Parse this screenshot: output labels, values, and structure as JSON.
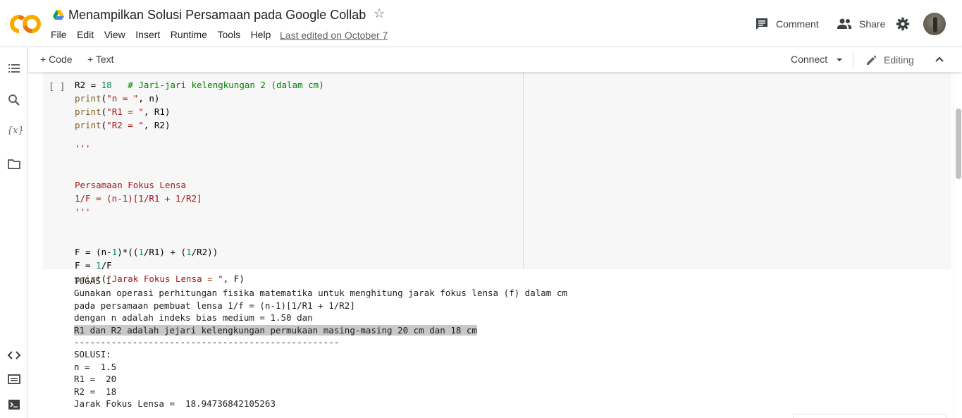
{
  "header": {
    "title": "Menampilkan Solusi Persamaan pada Google Collab",
    "menu": [
      "File",
      "Edit",
      "View",
      "Insert",
      "Runtime",
      "Tools",
      "Help"
    ],
    "last_edited": "Last edited on October 7",
    "comment_label": "Comment",
    "share_label": "Share"
  },
  "toolbar": {
    "add_code": "+ Code",
    "add_text": "+ Text",
    "connect": "Connect",
    "editing": "Editing"
  },
  "cell": {
    "run_indicator": "[ ]"
  },
  "code_lines": [
    "R2 = 18   # Jari-jari kelengkungan 2 (dalam cm)",
    "print(\"n = \", n)",
    "print(\"R1 = \", R1)",
    "print(\"R2 = \", R2)",
    "'''",
    "Persamaan Fokus Lensa",
    "1/F = (n-1)[1/R1 + 1/R2]",
    "'''",
    "F = (n-1)*((1/R1) + (1/R2))",
    "F = 1/F",
    "print(\"Jarak Fokus Lensa = \", F)"
  ],
  "output_lines": [
    "TUGAS 1",
    "Gunakan operasi perhitungan fisika matematika untuk menghitung jarak fokus lensa (f) dalam cm",
    "pada persamaan pembuat lensa 1/f = (n-1)[1/R1 + 1/R2]",
    "dengan n adalah indeks bias medium = 1.50 dan",
    "R1 dan R2 adalah jejari kelengkungan permukaan masing-masing 20 cm dan 18 cm",
    "--------------------------------------------------",
    "SOLUSI:",
    "n =  1.5",
    "R1 =  20",
    "R2 =  18",
    "Jarak Fokus Lensa =  18.94736842105263"
  ],
  "colors": {
    "logo_orange": "#F9AB00",
    "logo_dark_orange": "#E8710A",
    "highlight": "#c8c8c8"
  },
  "icons": [
    "colab-logo",
    "drive-icon",
    "star-icon",
    "comment-icon",
    "share-icon",
    "gear-icon",
    "avatar",
    "toc-icon",
    "search-icon",
    "variables-icon",
    "folder-icon",
    "code-snippets-icon",
    "command-palette-icon",
    "terminal-icon",
    "chevron-down-icon",
    "pencil-icon",
    "chevron-up-icon"
  ]
}
